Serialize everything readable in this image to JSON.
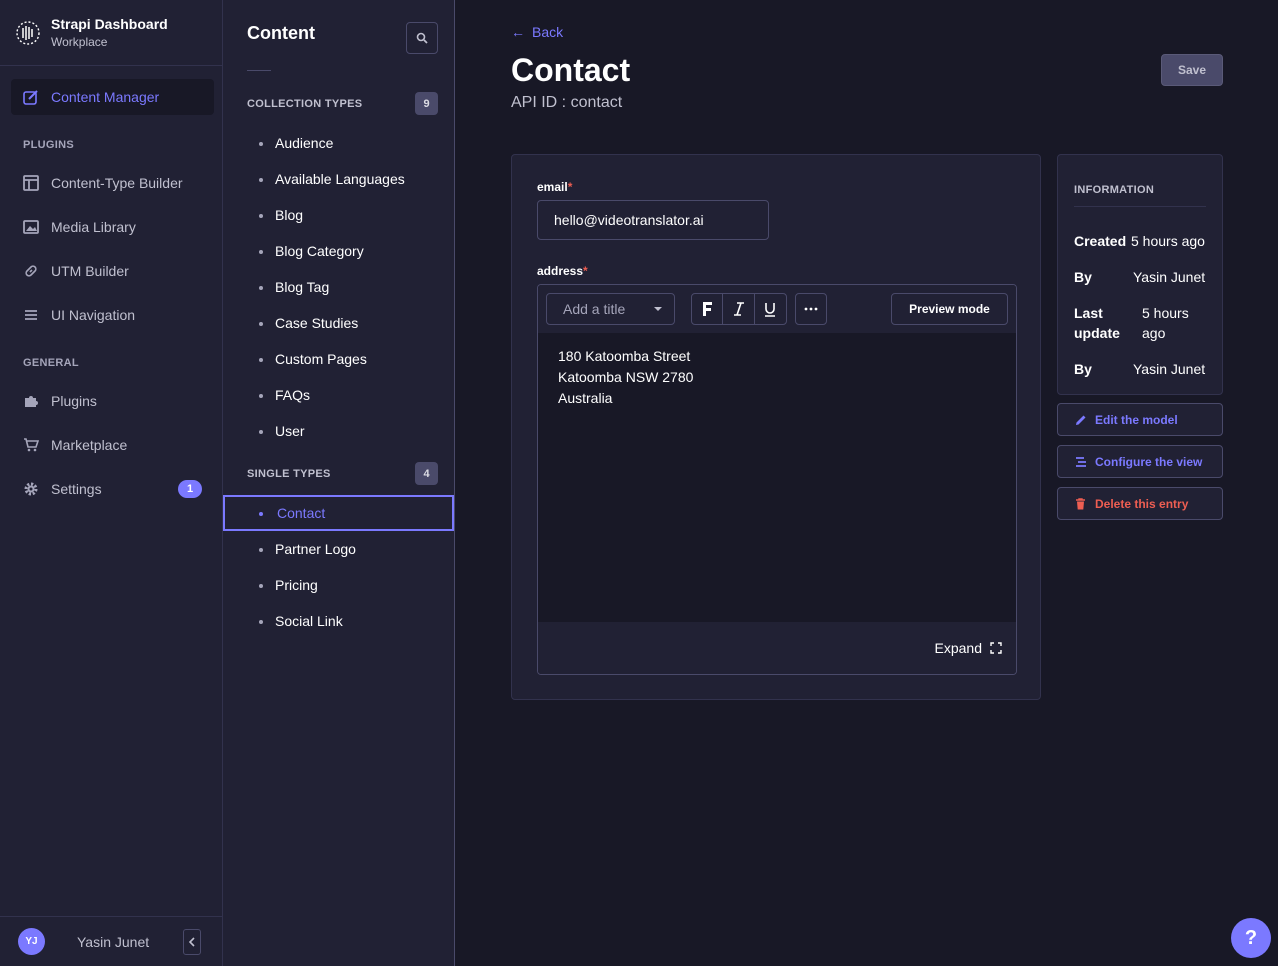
{
  "brand": {
    "title": "Strapi Dashboard",
    "subtitle": "Workplace"
  },
  "mainnav": {
    "active": {
      "label": "Content Manager",
      "icon": "feather-icon"
    },
    "plugins_section": "PLUGINS",
    "plugins": [
      {
        "label": "Content-Type Builder",
        "icon": "layout-icon"
      },
      {
        "label": "Media Library",
        "icon": "image-icon"
      },
      {
        "label": "UTM Builder",
        "icon": "link-icon"
      },
      {
        "label": "UI Navigation",
        "icon": "list-icon"
      }
    ],
    "general_section": "GENERAL",
    "general": [
      {
        "label": "Plugins",
        "icon": "puzzle-icon"
      },
      {
        "label": "Marketplace",
        "icon": "cart-icon"
      },
      {
        "label": "Settings",
        "icon": "gear-icon",
        "badge": "1"
      }
    ],
    "footer": {
      "initials": "YJ",
      "name": "Yasin Junet"
    }
  },
  "subnav": {
    "title": "Content",
    "collection_types": {
      "label": "COLLECTION TYPES",
      "count": "9",
      "items": [
        "Audience",
        "Available Languages",
        "Blog",
        "Blog Category",
        "Blog Tag",
        "Case Studies",
        "Custom Pages",
        "FAQs",
        "User"
      ]
    },
    "single_types": {
      "label": "SINGLE TYPES",
      "count": "4",
      "items": [
        "Contact",
        "Partner Logo",
        "Pricing",
        "Social Link"
      ],
      "active": "Contact"
    }
  },
  "header": {
    "back": "Back",
    "title": "Contact",
    "api_id": "API ID : contact",
    "save": "Save"
  },
  "form": {
    "email": {
      "label": "email",
      "required": "*",
      "value": "hello@videotranslator.ai"
    },
    "address": {
      "label": "address",
      "required": "*",
      "heading_placeholder": "Add a title",
      "preview": "Preview mode",
      "lines": [
        "180 Katoomba Street",
        "Katoomba NSW 2780",
        "Australia"
      ],
      "expand": "Expand"
    }
  },
  "info": {
    "heading": "INFORMATION",
    "created_label": "Created",
    "created_value": "5 hours ago",
    "by_label": "By",
    "by_value": "Yasin Junet",
    "last_label_1": "Last",
    "last_label_2": "update",
    "last_value_1": "5 hours",
    "last_value_2": "ago",
    "by2_label": "By",
    "by2_value": "Yasin Junet"
  },
  "actions": {
    "edit_model": "Edit the model",
    "configure_view": "Configure the view",
    "delete_entry": "Delete this entry"
  },
  "help": "?",
  "colors": {
    "accent": "#7b79ff",
    "danger": "#ee5e52",
    "background": "#181826",
    "surface": "#212134"
  }
}
